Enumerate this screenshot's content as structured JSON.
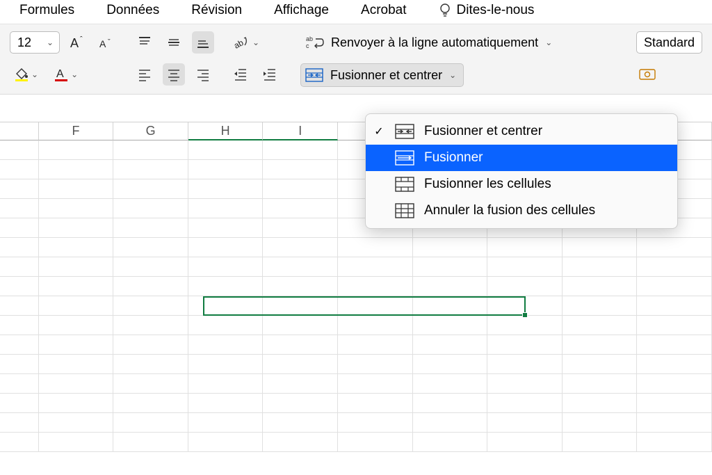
{
  "tabs": {
    "formulas": "Formules",
    "data": "Données",
    "review": "Révision",
    "view": "Affichage",
    "acrobat": "Acrobat",
    "tellme": "Dites-le-nous"
  },
  "toolbar": {
    "fontSize": "12",
    "wrapText": "Renvoyer à la ligne automatiquement",
    "mergeCenter": "Fusionner et centrer",
    "numberFormat": "Standard"
  },
  "menu": {
    "items": [
      {
        "label": "Fusionner et centrer",
        "checked": true,
        "selected": false
      },
      {
        "label": "Fusionner",
        "checked": false,
        "selected": true
      },
      {
        "label": "Fusionner les cellules",
        "checked": false,
        "selected": false
      },
      {
        "label": "Annuler la fusion des cellules",
        "checked": false,
        "selected": false
      }
    ]
  },
  "columns": [
    "F",
    "G",
    "H",
    "I"
  ],
  "colors": {
    "highlight": "#fff200",
    "fontRed": "#d60000",
    "selection": "#107c41",
    "menuSelect": "#0a63ff"
  }
}
